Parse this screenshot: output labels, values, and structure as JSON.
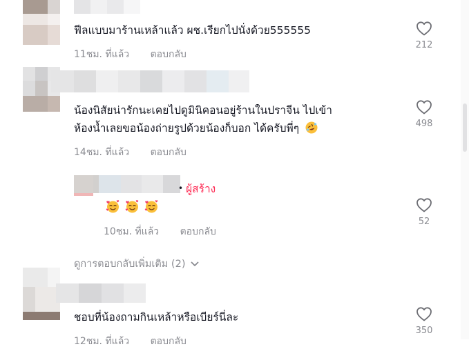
{
  "comments": [
    {
      "text": "ฟีลแบบมาร้านเหล้าแล้ว ผช.เรียกไปนั่งด้วย555555",
      "time": "11ชม. ที่แล้ว",
      "reply_label": "ตอบกลับ",
      "likes": "212"
    },
    {
      "text_line1": "น้องนิสัยน่ารักนะเคยไปดูมินิคอนอยู่ร้านในปราจีน ไปเข้า",
      "text_line2": "ห้องน้ำเลยขอน้องถ่ายรูปด้วยน้องก็บอก ได้ครับพี่ๆ",
      "emoji": "rolling-on-floor-laughing",
      "time": "14ชม. ที่แล้ว",
      "reply_label": "ตอบกลับ",
      "likes": "498"
    }
  ],
  "creator_reply": {
    "separator": "•",
    "badge": "ผู้สร้าง",
    "emojis": [
      "smiling-face-with-hearts",
      "smiling-face-with-hearts",
      "smiling-face-with-hearts"
    ],
    "time": "10ชม. ที่แล้ว",
    "reply_label": "ตอบกลับ",
    "likes": "52"
  },
  "more_replies": {
    "label": "ดูการตอบกลับเพิ่มเติม (2)",
    "icon": "chevron-down-icon"
  },
  "last_comment": {
    "text": "ชอบที่น้องถามกินเหล้าหรือเบียร์นี่ละ",
    "time": "12ชม. ที่แล้ว",
    "reply_label": "ตอบกลับ",
    "likes": "350"
  },
  "icons": {
    "like": "heart-outline-icon"
  },
  "colors": {
    "accent": "#fe2c55",
    "secondary_text": "#8a8b91",
    "primary_text": "#161823"
  }
}
